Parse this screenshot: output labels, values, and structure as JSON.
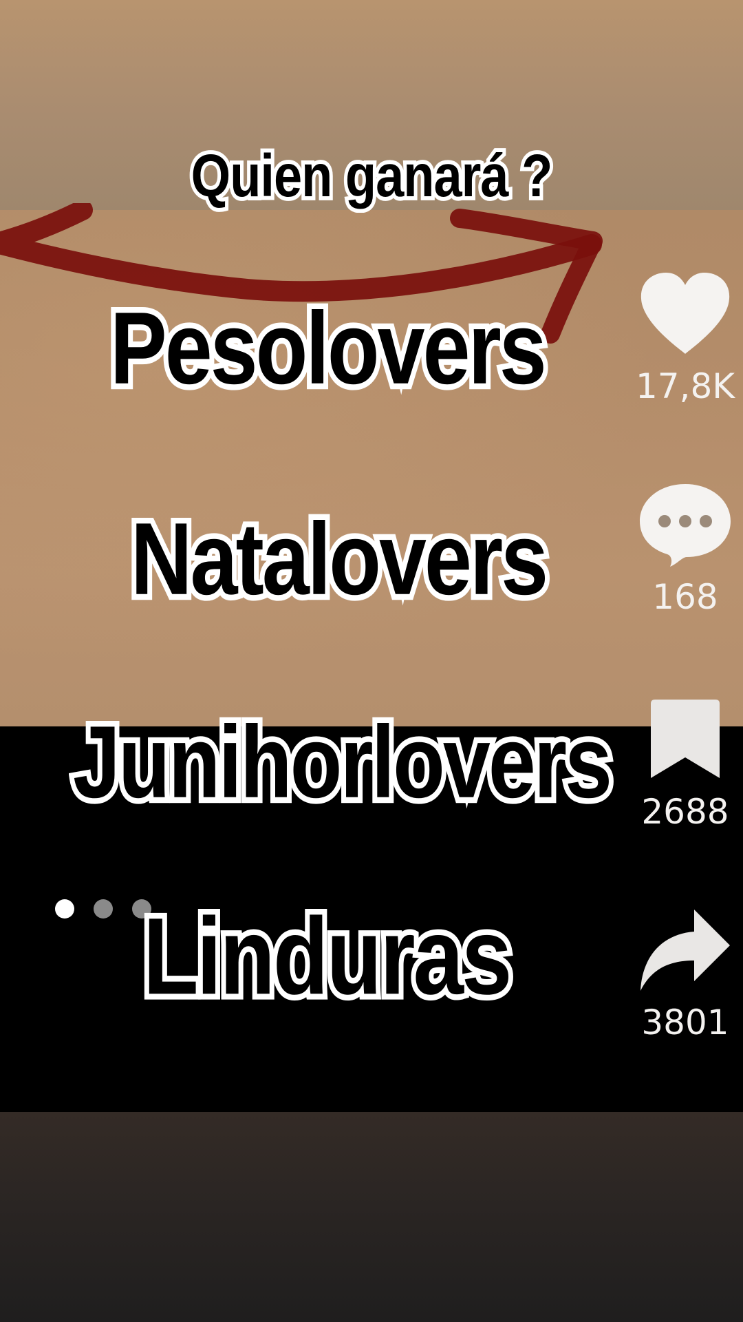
{
  "video": {
    "title_caption": "Quien ganará ?",
    "captions": [
      "Pesolovers",
      "Natalovers",
      "Junihorlovers",
      "Linduras"
    ]
  },
  "pagination": {
    "dot_count": 3,
    "active_index": 0
  },
  "actions": {
    "like": {
      "icon": "heart-icon",
      "count": "17,8K"
    },
    "comment": {
      "icon": "comment-bubble-icon",
      "count": "168"
    },
    "save": {
      "icon": "bookmark-icon",
      "count": "2688"
    },
    "share": {
      "icon": "share-arrow-icon",
      "count": "3801"
    }
  },
  "colors": {
    "caption_fill": "#000000",
    "caption_outline": "#ffffff",
    "arrow": "#7a0f0c",
    "icon": "#f5f3f1"
  }
}
